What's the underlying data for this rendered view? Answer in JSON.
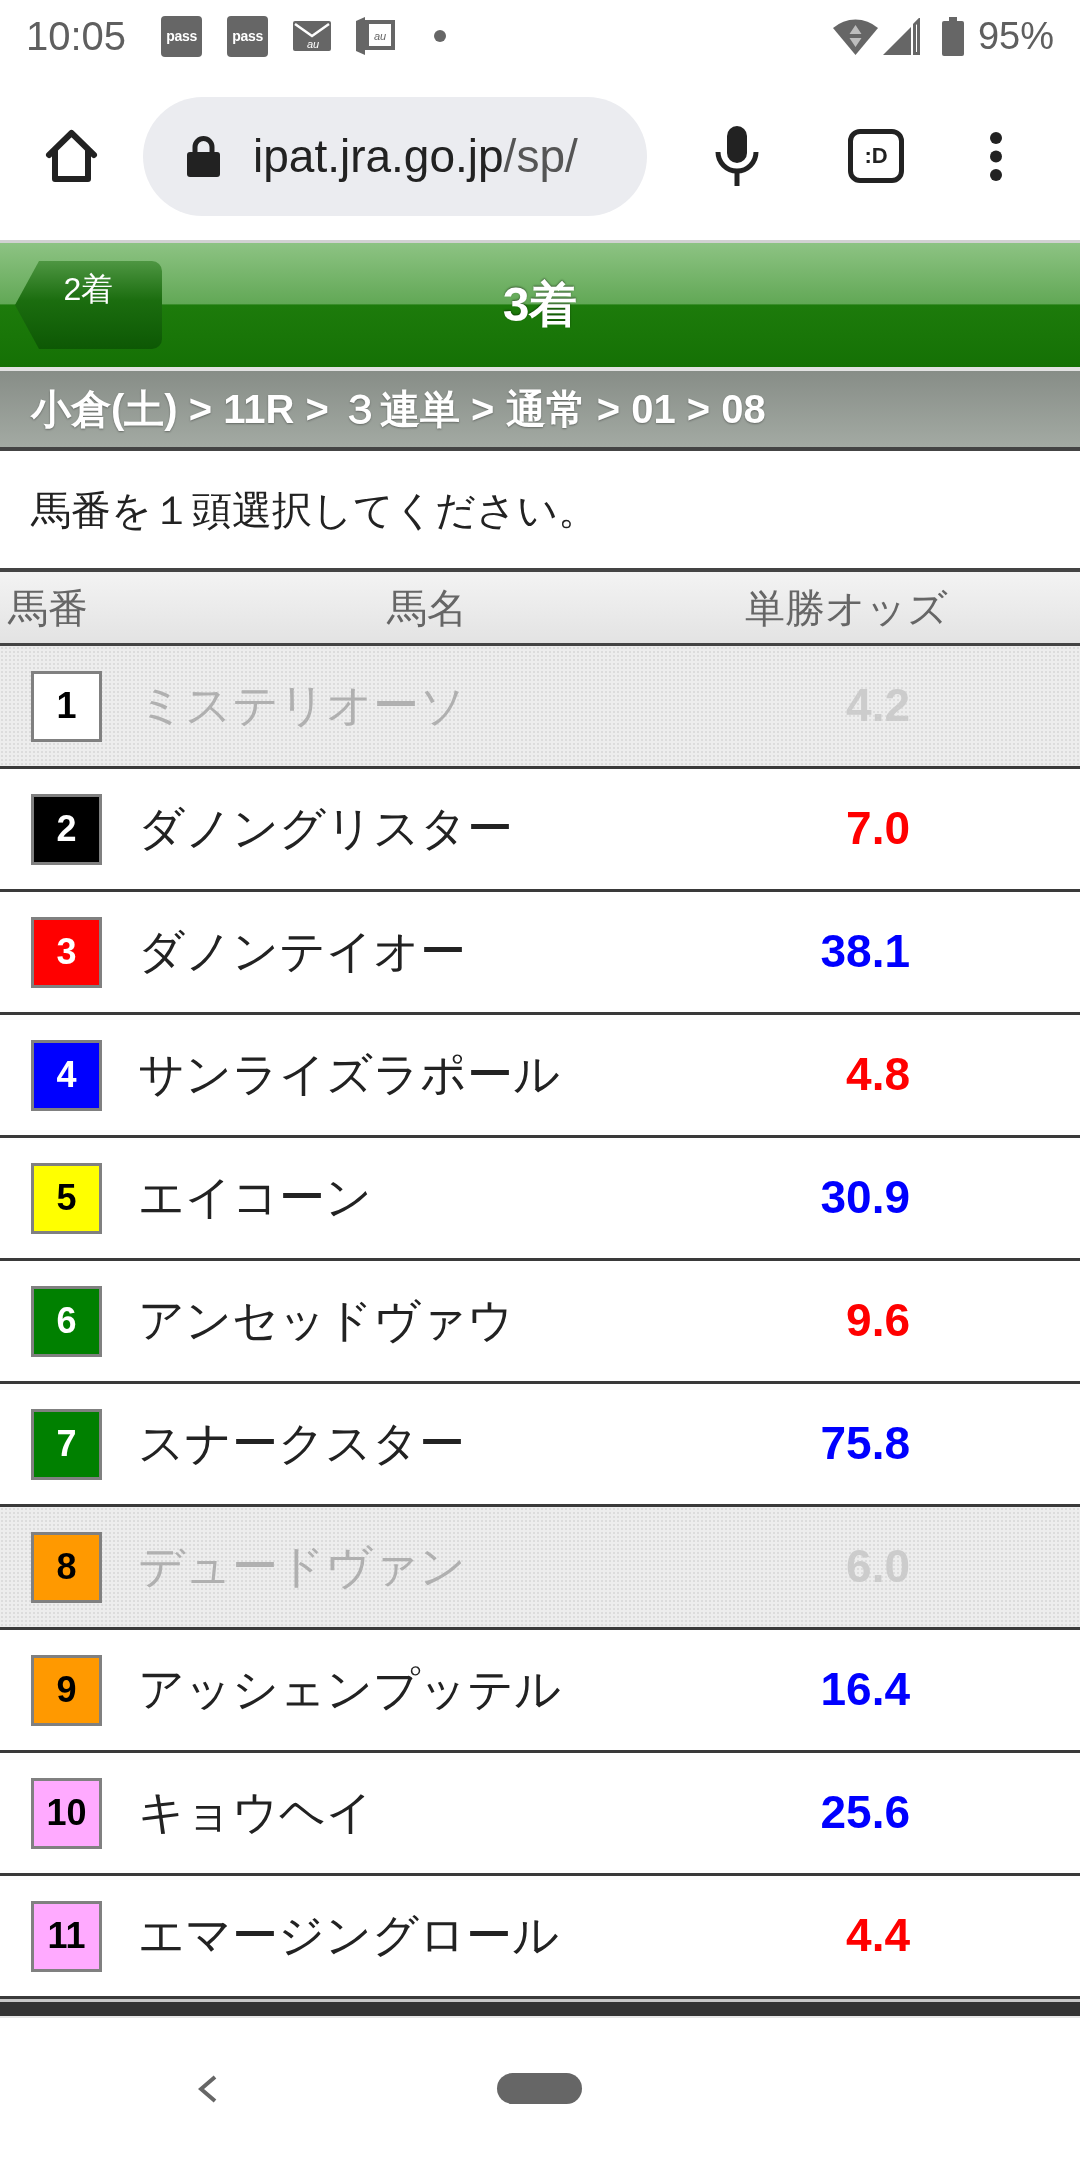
{
  "status_bar": {
    "time": "10:05",
    "notifications": [
      {
        "kind": "pass",
        "label": "pass"
      },
      {
        "kind": "pass",
        "label": "pass"
      },
      {
        "kind": "mail",
        "label": "au"
      },
      {
        "kind": "book",
        "label": "au"
      },
      {
        "kind": "dot"
      }
    ],
    "battery": "95%"
  },
  "browser": {
    "url_host": "ipat.jra.go.jp",
    "url_path": "/sp/",
    "tab_button": ":D"
  },
  "header": {
    "back_button": "2着",
    "title": "3着"
  },
  "breadcrumb": "小倉(土) > 11R > ３連単 > 通常 > 01 > 08",
  "instruction": "馬番を１頭選択してください。",
  "table": {
    "columns": [
      "馬番",
      "馬名",
      "単勝オッズ"
    ],
    "rows": [
      {
        "number": "1",
        "color": "#ffffff",
        "name": "ミステリオーソ",
        "odds": {
          "text": "4.2",
          "color": "#cccccc"
        },
        "disabled": true
      },
      {
        "number": "2",
        "color": "#000000",
        "name": "ダノングリスター",
        "odds": {
          "text": "7.0",
          "color": "#ff0000"
        },
        "disabled": false
      },
      {
        "number": "3",
        "color": "#ff0000",
        "name": "ダノンテイオー",
        "odds": {
          "text": "38.1",
          "color": "#0000ff"
        },
        "disabled": false
      },
      {
        "number": "4",
        "color": "#0000ff",
        "name": "サンライズラポール",
        "odds": {
          "text": "4.8",
          "color": "#ff0000"
        },
        "disabled": false
      },
      {
        "number": "5",
        "color": "#ffff00",
        "name": "エイコーン",
        "odds": {
          "text": "30.9",
          "color": "#0000ff"
        },
        "disabled": false
      },
      {
        "number": "6",
        "color": "#008000",
        "name": "アンセッドヴァウ",
        "odds": {
          "text": "9.6",
          "color": "#ff0000"
        },
        "disabled": false
      },
      {
        "number": "7",
        "color": "#008000",
        "name": "スナークスター",
        "odds": {
          "text": "75.8",
          "color": "#0000ff"
        },
        "disabled": false
      },
      {
        "number": "8",
        "color": "#ff9900",
        "name": "デュードヴァン",
        "odds": {
          "text": "6.0",
          "color": "#cccccc"
        },
        "disabled": true
      },
      {
        "number": "9",
        "color": "#ff9900",
        "name": "アッシェンプッテル",
        "odds": {
          "text": "16.4",
          "color": "#0000ff"
        },
        "disabled": false
      },
      {
        "number": "10",
        "color": "#ffaaff",
        "name": "キョウヘイ",
        "odds": {
          "text": "25.6",
          "color": "#0000ff"
        },
        "disabled": false
      },
      {
        "number": "11",
        "color": "#ffaaff",
        "name": "エマージングロール",
        "odds": {
          "text": "4.4",
          "color": "#ff0000"
        },
        "disabled": false
      }
    ]
  }
}
